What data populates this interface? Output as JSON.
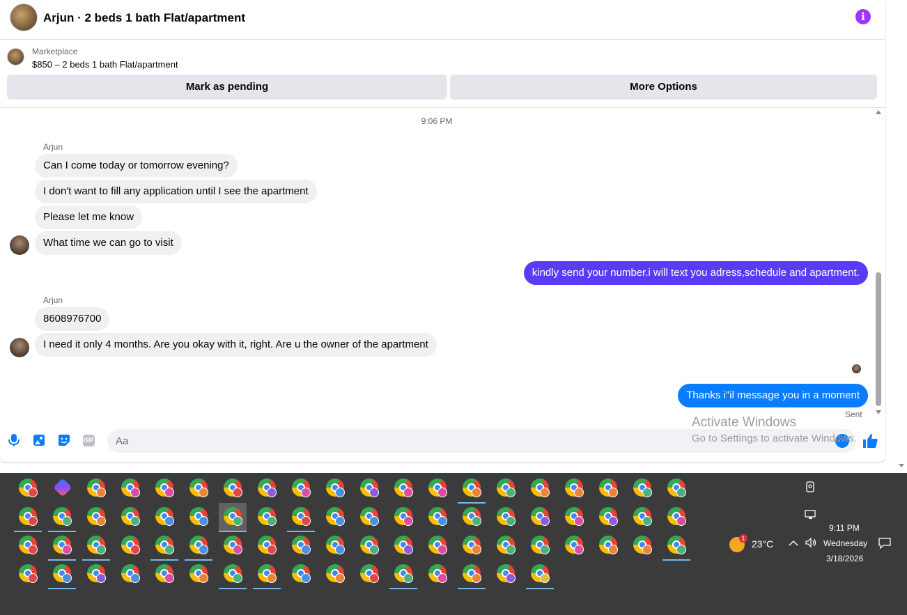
{
  "header": {
    "title": "Arjun · 2 beds 1 bath Flat/apartment",
    "info_icon": "info-icon",
    "accent_color": "#a033ff"
  },
  "listing": {
    "source": "Marketplace",
    "title": "$850 – 2 beds 1 bath Flat/apartment",
    "mark_pending_label": "Mark as pending",
    "more_options_label": "More Options"
  },
  "conversation": {
    "timestamp": "9:06 PM",
    "group1": {
      "sender": "Arjun",
      "messages": [
        "Can I come today or tomorrow evening?",
        "I don't want to fill any application until I see the apartment",
        "Please let me know",
        "What time we can go to visit"
      ]
    },
    "outgoing1": "kindly send your number.i will text you adress,schedule and apartment.",
    "group2": {
      "sender": "Arjun",
      "messages": [
        "8608976700",
        "I need it only 4 months. Are you okay with it, right. Are u the owner of the apartment"
      ]
    },
    "outgoing2": "Thanks i\"il message you in a moment",
    "status": "Sent",
    "outgoing_color": "#0a7cff",
    "outgoing_purple_color": "#5b3cf5"
  },
  "composer": {
    "placeholder": "Aa",
    "icons": [
      "microphone-icon",
      "photo-icon",
      "sticker-icon",
      "gif-icon",
      "emoji-icon",
      "thumbs-up-icon"
    ],
    "gif_label": "GIF"
  },
  "watermark": {
    "title": "Activate Windows",
    "subtitle": "Go to Settings to activate Windows."
  },
  "taskbar": {
    "weather": {
      "temperature": "23°C",
      "badge": "1"
    },
    "clock": {
      "time": "9:11 PM",
      "day": "Wednesday",
      "date": "3/18/2026"
    },
    "app_rows": [
      [
        "chrome-red",
        "copilot",
        "chrome-orange",
        "chrome-pink",
        "chrome-pink",
        "chrome-orange",
        "chrome-red",
        "chrome-purple",
        "chrome-pink",
        "chrome-blue",
        "chrome-purple",
        "chrome-pink",
        "chrome-pink",
        "chrome-orange",
        "chrome-green",
        "chrome-orange",
        "chrome-orange",
        "chrome-orange",
        "chrome-green",
        "chrome-green"
      ],
      [
        "chrome-red",
        "chrome-green",
        "chrome-orange",
        "chrome-green",
        "chrome-blue",
        "chrome-blue",
        "chrome-green",
        "chrome-green",
        "chrome-red",
        "chrome-blue",
        "chrome-blue",
        "chrome-pink",
        "chrome-blue",
        "chrome-green",
        "chrome-green",
        "chrome-purple",
        "chrome-pink",
        "chrome-purple",
        "chrome-green",
        "chrome-pink"
      ],
      [
        "chrome-red",
        "chrome-pink",
        "chrome-green",
        "chrome-red",
        "chrome-green",
        "chrome-blue",
        "chrome-pink",
        "chrome-red",
        "chrome-blue",
        "chrome-blue",
        "chrome-green",
        "chrome-purple",
        "chrome-pink",
        "chrome-orange",
        "chrome-green",
        "chrome-green",
        "chrome-pink",
        "chrome-orange",
        "chrome-orange",
        "chrome-green"
      ],
      [
        "chrome-red",
        "chrome-blue",
        "chrome-purple",
        "chrome-blue",
        "chrome-pink",
        "chrome-orange",
        "chrome-green",
        "chrome-orange",
        "chrome-blue",
        "chrome-orange",
        "chrome-red",
        "chrome-green",
        "chrome-pink",
        "chrome-orange",
        "chrome-purple",
        "chrome-yellow"
      ]
    ]
  }
}
